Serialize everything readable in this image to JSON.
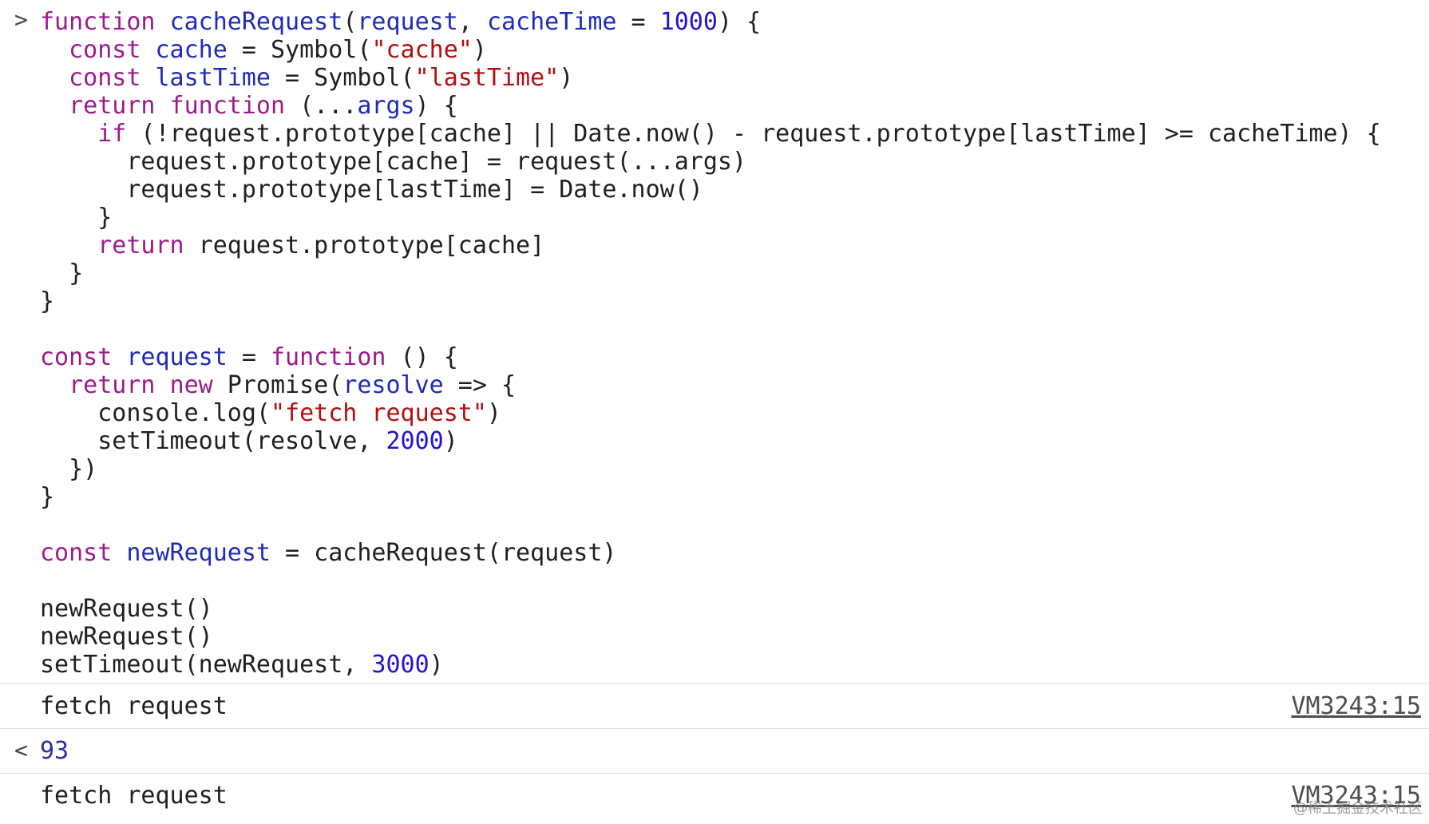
{
  "console": {
    "prompt_symbol": ">",
    "return_symbol": "<",
    "code_lines": [
      "function cacheRequest(request, cacheTime = 1000) {",
      "  const cache = Symbol(\"cache\")",
      "  const lastTime = Symbol(\"lastTime\")",
      "  return function (...args) {",
      "    if (!request.prototype[cache] || Date.now() - request.prototype[lastTime] >= cacheTime) {",
      "      request.prototype[cache] = request(...args)",
      "      request.prototype[lastTime] = Date.now()",
      "    }",
      "    return request.prototype[cache]",
      "  }",
      "}",
      "",
      "const request = function () {",
      "  return new Promise(resolve => {",
      "    console.log(\"fetch request\")",
      "    setTimeout(resolve, 2000)",
      "  })",
      "}",
      "",
      "const newRequest = cacheRequest(request)",
      "",
      "newRequest()",
      "newRequest()",
      "setTimeout(newRequest, 3000)"
    ],
    "logs": [
      {
        "text": "fetch request",
        "source": "VM3243:15"
      },
      {
        "text": "93",
        "source": ""
      },
      {
        "text": "fetch request",
        "source": "VM3243:15"
      }
    ],
    "watermark": "@稀土掘金技术社区"
  },
  "colors": {
    "keyword": "#9c1b8b",
    "identifier": "#1f2bb8",
    "string": "#b30f0f",
    "number": "#2314d1",
    "text": "#1f1f1f",
    "divider": "#d8dde8",
    "result": "#2b2fa3"
  },
  "icons": {
    "prompt": "chevron-right-icon",
    "return": "return-arrow-icon"
  }
}
